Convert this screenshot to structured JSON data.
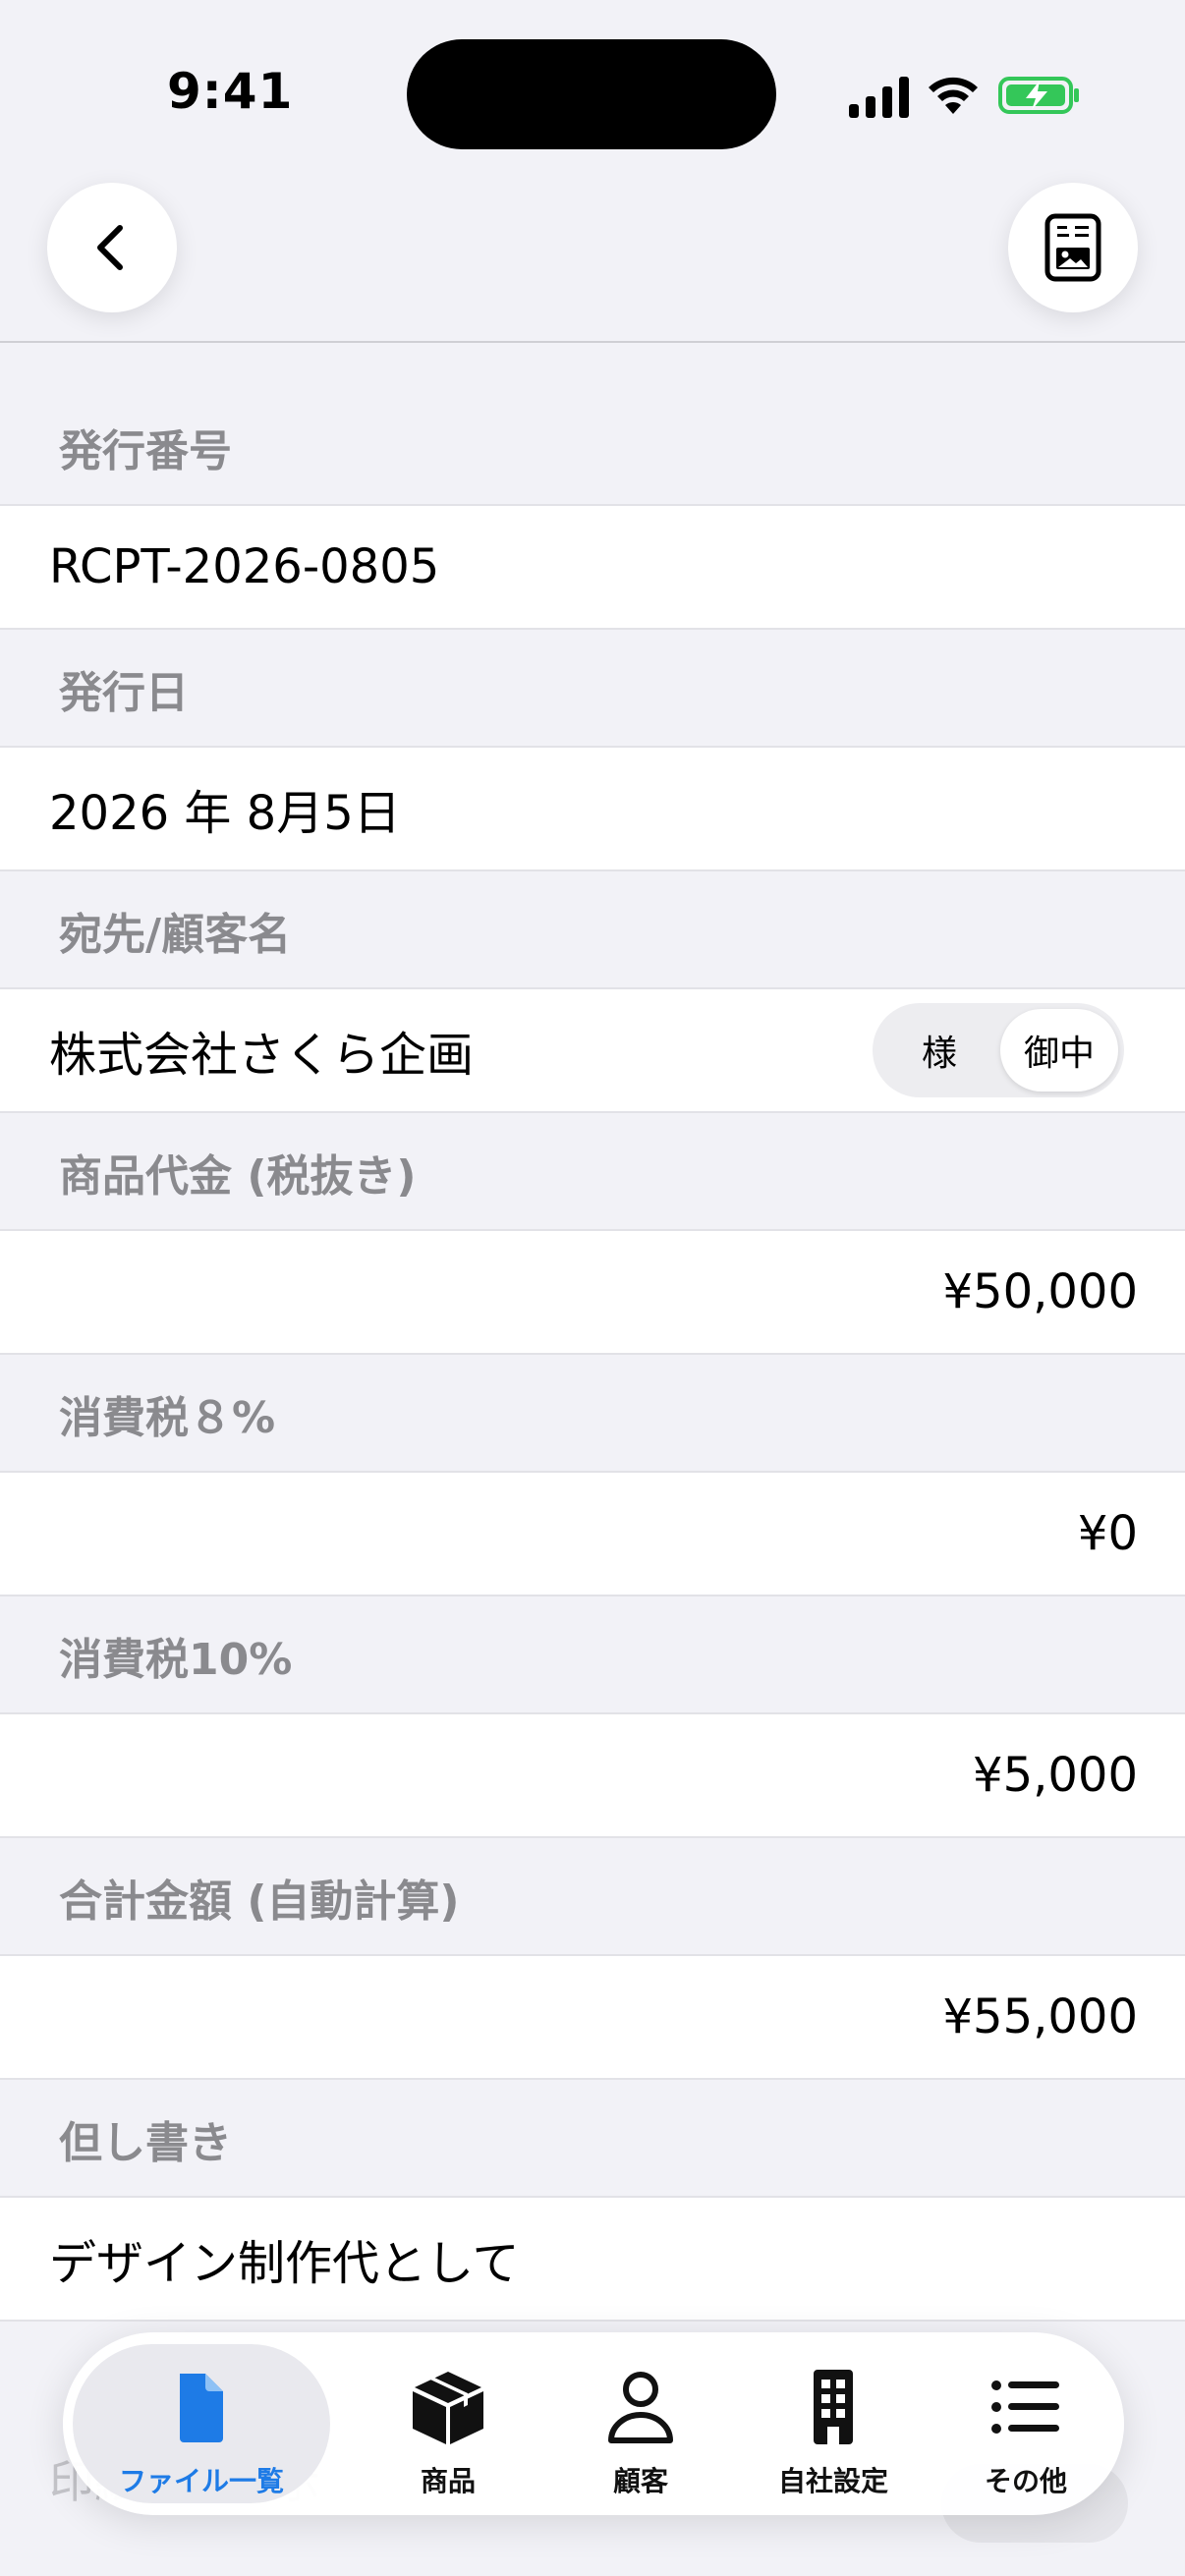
{
  "status": {
    "time": "9:41"
  },
  "nav": {
    "back_icon": "chevron-left-icon",
    "action_icon": "contact-card-icon"
  },
  "form": {
    "sections": [
      {
        "label": "発行番号",
        "value": "RCPT-2026-0805"
      },
      {
        "label": "発行日",
        "value": "2026 年 8月5日"
      },
      {
        "label": "宛先/顧客名",
        "value": "株式会社さくら企画"
      },
      {
        "label": "商品代金 (税抜き)",
        "value": "¥50,000"
      },
      {
        "label": "消費税８%",
        "value": "¥0"
      },
      {
        "label": "消費税10%",
        "value": "¥5,000"
      },
      {
        "label": "合計金額 (自動計算)",
        "value": "¥55,000"
      },
      {
        "label": "但し書き",
        "value": "デザイン制作代として"
      }
    ],
    "honorific": {
      "options": [
        "様",
        "御中"
      ],
      "selected": "御中"
    },
    "partial_row_label": "印紙欄の表示"
  },
  "tabs": [
    {
      "label": "ファイル一覧",
      "icon": "document-icon",
      "active": true
    },
    {
      "label": "商品",
      "icon": "box-icon",
      "active": false
    },
    {
      "label": "顧客",
      "icon": "person-icon",
      "active": false
    },
    {
      "label": "自社設定",
      "icon": "building-icon",
      "active": false
    },
    {
      "label": "その他",
      "icon": "list-icon",
      "active": false
    }
  ],
  "colors": {
    "accent": "#1E7BE6",
    "background": "#F2F2F7",
    "battery": "#34C759"
  }
}
